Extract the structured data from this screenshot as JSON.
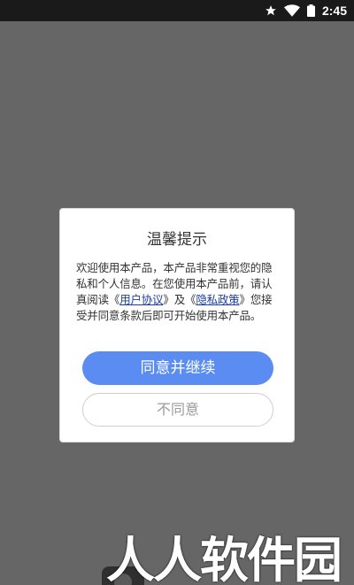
{
  "status_bar": {
    "time": "2:45",
    "icons": [
      "star-icon",
      "wifi-icon",
      "battery-icon"
    ]
  },
  "dialog": {
    "title": "温馨提示",
    "body_prefix": "欢迎使用本产品，本产品非常重视您的隐私和个人信息。在您使用本产品前，请认真阅读《",
    "user_agreement_link": "用户协议",
    "body_middle": "》及《",
    "privacy_policy_link": "隐私政策",
    "body_suffix": "》您接受并同意条款后即可开始使用本产品。",
    "agree_button": "同意并继续",
    "disagree_button": "不同意"
  },
  "watermark": "人人软件园",
  "colors": {
    "overlay": "#666666",
    "primary_button": "#5a8cf2",
    "link": "#1b3fa6"
  }
}
